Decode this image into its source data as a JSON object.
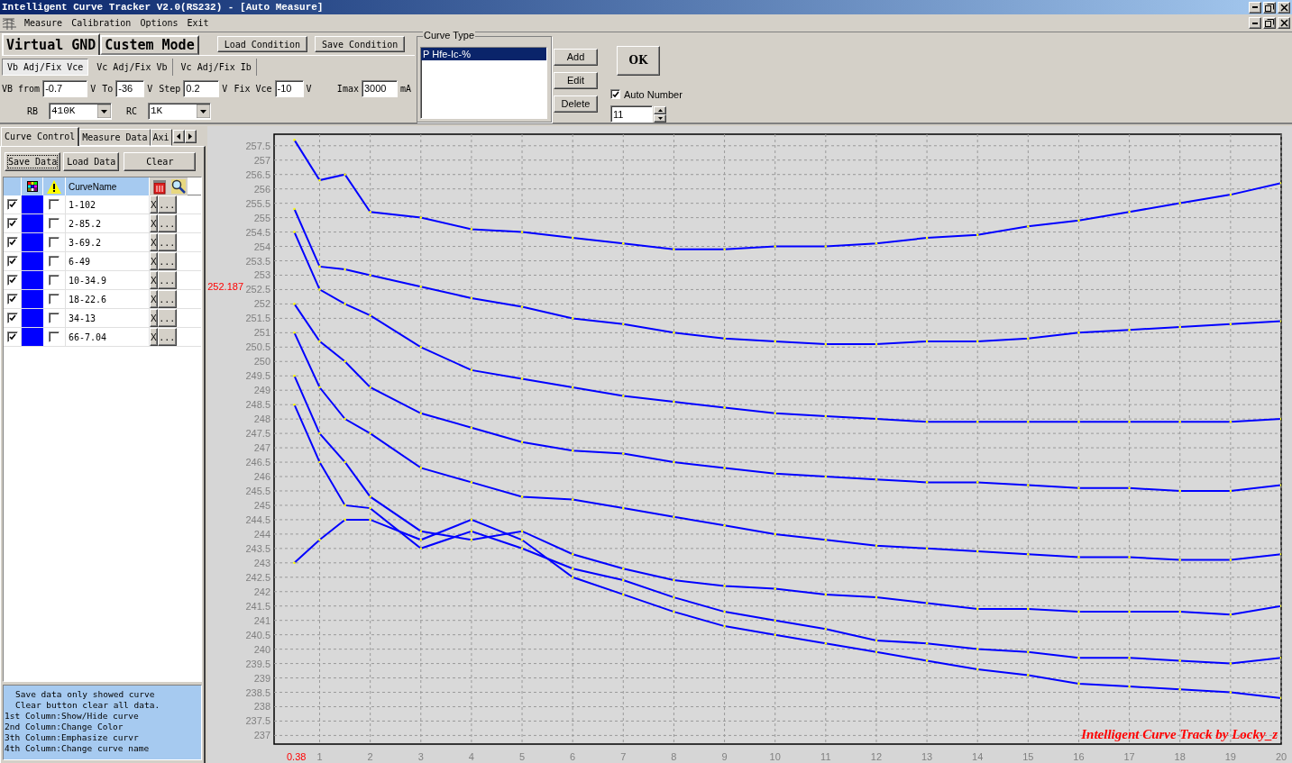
{
  "window": {
    "title": "Intelligent Curve Tracker V2.0(RS232) - [Auto Measure]"
  },
  "menu": [
    "Measure",
    "Calibration",
    "Options",
    "Exit"
  ],
  "mode_tabs": [
    {
      "label": "Virtual GND",
      "selected": true
    },
    {
      "label": "Custem Mode",
      "selected": false
    }
  ],
  "condition_buttons": [
    "Load Condition",
    "Save Condition"
  ],
  "sweep_tabs": [
    {
      "label": "Vb Adj/Fix Vce",
      "selected": true
    },
    {
      "label": "Vc Adj/Fix Vb",
      "selected": false
    },
    {
      "label": "Vc Adj/Fix Ib",
      "selected": false
    }
  ],
  "params": [
    {
      "label": "VB from",
      "value": "-0.7",
      "unit": "V"
    },
    {
      "label": "To",
      "value": "-36",
      "unit": "V"
    },
    {
      "label": "Step",
      "value": "0.2",
      "unit": "V"
    },
    {
      "label": "Fix Vce",
      "value": "-10",
      "unit": "V"
    },
    {
      "label": "Imax",
      "value": "3000",
      "unit": "mA"
    }
  ],
  "resistors": [
    {
      "label": "RB",
      "value": "410K"
    },
    {
      "label": "RC",
      "value": "1K"
    }
  ],
  "curve_type": {
    "title": "Curve Type",
    "items": [
      {
        "label": "P Hfe-Ic-%",
        "selected": true
      }
    ],
    "buttons": [
      "Add",
      "Edit",
      "Delete"
    ]
  },
  "ok_button": "OK",
  "auto_number": {
    "label": "Auto Number",
    "checked": true,
    "value": "11"
  },
  "side_tabs": [
    {
      "label": "Curve Control",
      "selected": true
    },
    {
      "label": "Measure Data",
      "selected": false
    },
    {
      "label": "Axi",
      "selected": false
    }
  ],
  "data_buttons": [
    {
      "label": "Save Data",
      "focused": true
    },
    {
      "label": "Load Data",
      "focused": false
    },
    {
      "label": "Clear",
      "focused": false
    }
  ],
  "curves": {
    "header": "CurveName",
    "rows": [
      {
        "visible": true,
        "color": "#0000ff",
        "emphasized": false,
        "name": "1-102",
        "delete": "X",
        "edit": "..."
      },
      {
        "visible": true,
        "color": "#0000ff",
        "emphasized": false,
        "name": "2-85.2",
        "delete": "X",
        "edit": "..."
      },
      {
        "visible": true,
        "color": "#0000ff",
        "emphasized": false,
        "name": "3-69.2",
        "delete": "X",
        "edit": "..."
      },
      {
        "visible": true,
        "color": "#0000ff",
        "emphasized": false,
        "name": "6-49",
        "delete": "X",
        "edit": "..."
      },
      {
        "visible": true,
        "color": "#0000ff",
        "emphasized": false,
        "name": "10-34.9",
        "delete": "X",
        "edit": "..."
      },
      {
        "visible": true,
        "color": "#0000ff",
        "emphasized": false,
        "name": "18-22.6",
        "delete": "X",
        "edit": "..."
      },
      {
        "visible": true,
        "color": "#0000ff",
        "emphasized": false,
        "name": "34-13",
        "delete": "X",
        "edit": "..."
      },
      {
        "visible": true,
        "color": "#0000ff",
        "emphasized": false,
        "name": "66-7.04",
        "delete": "X",
        "edit": "..."
      }
    ]
  },
  "help_text": [
    {
      "kind": "note",
      "text": "Save data only showed curve"
    },
    {
      "kind": "note",
      "text": "Clear button clear all data."
    },
    {
      "kind": "column",
      "text": "1st Column:Show/Hide curve"
    },
    {
      "kind": "column",
      "text": "2nd Column:Change Color"
    },
    {
      "kind": "column",
      "text": "3th Column:Emphasize curvr"
    },
    {
      "kind": "column",
      "text": "4th Column:Change curve name"
    }
  ],
  "chart": {
    "credit": "Intelligent Curve Track by Locky_z",
    "chart_data": {
      "type": "line",
      "x": [
        0.5,
        1,
        1.5,
        2,
        3,
        4,
        5,
        6,
        7,
        8,
        9,
        10,
        11,
        12,
        13,
        14,
        15,
        16,
        17,
        18,
        19,
        20
      ],
      "series": [
        {
          "color": "#0000ff",
          "values": [
            257.7,
            256.3,
            256.5,
            255.2,
            255.0,
            254.6,
            254.5,
            254.3,
            254.1,
            253.9,
            253.9,
            254.0,
            254.0,
            254.1,
            254.3,
            254.4,
            254.7,
            254.9,
            255.2,
            255.5,
            255.8,
            256.2
          ]
        },
        {
          "color": "#0000ff",
          "values": [
            255.3,
            253.3,
            253.2,
            253.0,
            252.6,
            252.2,
            251.9,
            251.5,
            251.3,
            251.0,
            250.8,
            250.7,
            250.6,
            250.6,
            250.7,
            250.7,
            250.8,
            251.0,
            251.1,
            251.2,
            251.3,
            251.4
          ]
        },
        {
          "color": "#0000ff",
          "values": [
            254.5,
            252.5,
            252.0,
            251.6,
            250.5,
            249.7,
            249.4,
            249.1,
            248.8,
            248.6,
            248.4,
            248.2,
            248.1,
            248.0,
            247.9,
            247.9,
            247.9,
            247.9,
            247.9,
            247.9,
            247.9,
            248.0
          ]
        },
        {
          "color": "#0000ff",
          "values": [
            252.0,
            250.7,
            250.0,
            249.1,
            248.2,
            247.7,
            247.2,
            246.9,
            246.8,
            246.5,
            246.3,
            246.1,
            246.0,
            245.9,
            245.8,
            245.8,
            245.7,
            245.6,
            245.6,
            245.5,
            245.5,
            245.7
          ]
        },
        {
          "color": "#0000ff",
          "values": [
            251.0,
            249.1,
            248.0,
            247.5,
            246.3,
            245.8,
            245.3,
            245.2,
            244.9,
            244.6,
            244.3,
            244.0,
            243.8,
            243.6,
            243.5,
            243.4,
            243.3,
            243.2,
            243.2,
            243.1,
            243.1,
            243.3
          ]
        },
        {
          "color": "#0000ff",
          "values": [
            249.5,
            247.5,
            246.5,
            245.3,
            244.1,
            243.8,
            244.1,
            243.3,
            242.8,
            242.4,
            242.2,
            242.1,
            241.9,
            241.8,
            241.6,
            241.4,
            241.4,
            241.3,
            241.3,
            241.3,
            241.2,
            241.5
          ]
        },
        {
          "color": "#0000ff",
          "values": [
            248.5,
            246.5,
            245.0,
            244.9,
            243.5,
            244.1,
            243.5,
            242.8,
            242.4,
            241.8,
            241.3,
            241.0,
            240.7,
            240.3,
            240.2,
            240.0,
            239.9,
            239.7,
            239.7,
            239.6,
            239.5,
            239.7
          ]
        },
        {
          "color": "#0000ff",
          "values": [
            243.0,
            243.8,
            244.5,
            244.5,
            243.8,
            244.5,
            243.8,
            242.5,
            241.9,
            241.3,
            240.8,
            240.5,
            240.2,
            239.9,
            239.6,
            239.3,
            239.1,
            238.8,
            238.7,
            238.6,
            238.5,
            238.3
          ]
        }
      ],
      "xlim": [
        0.1,
        20
      ],
      "ylim": [
        236.7,
        257.9
      ],
      "xticks": [
        1,
        2,
        3,
        4,
        5,
        6,
        7,
        8,
        9,
        10,
        11,
        12,
        13,
        14,
        15,
        16,
        17,
        18,
        19,
        20
      ],
      "yticks": [
        237,
        237.5,
        238,
        238.5,
        239,
        239.5,
        240,
        240.5,
        241,
        241.5,
        242,
        242.5,
        243,
        243.5,
        244,
        244.5,
        245,
        245.5,
        246,
        246.5,
        247,
        247.5,
        248,
        248.5,
        249,
        249.5,
        250,
        250.5,
        251,
        251.5,
        252,
        252.5,
        253,
        253.5,
        254,
        254.5,
        255,
        255.5,
        256,
        256.5,
        257,
        257.5
      ],
      "grid": true
    },
    "cursor": {
      "y_reading": "252.187",
      "x_reading": "0.38"
    }
  }
}
